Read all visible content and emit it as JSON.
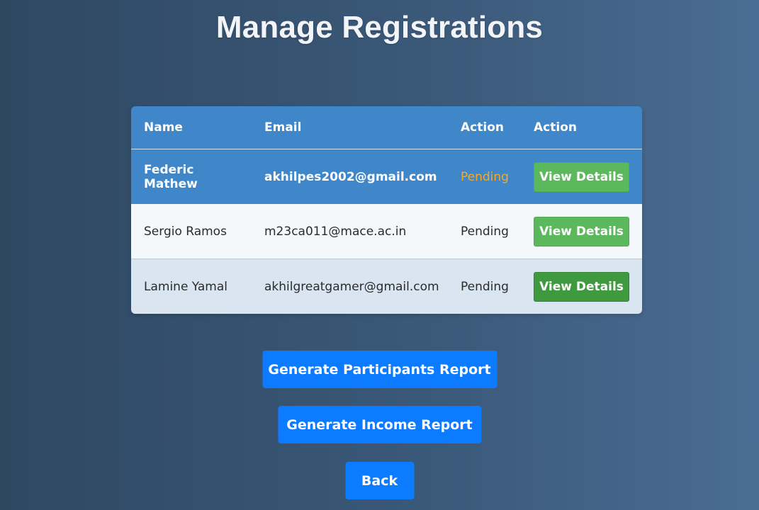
{
  "page": {
    "title": "Manage Registrations"
  },
  "table": {
    "headers": [
      "Name",
      "Email",
      "Action",
      "Action"
    ],
    "rows": [
      {
        "name": "Federic Mathew",
        "email": "akhilpes2002@gmail.com",
        "status": "Pending",
        "action_label": "View Details"
      },
      {
        "name": "Sergio Ramos",
        "email": "m23ca011@mace.ac.in",
        "status": "Pending",
        "action_label": "View Details"
      },
      {
        "name": "Lamine Yamal",
        "email": "akhilgreatgamer@gmail.com",
        "status": "Pending",
        "action_label": "View Details"
      }
    ]
  },
  "buttons": {
    "participants_report": "Generate Participants Report",
    "income_report": "Generate Income Report",
    "back": "Back"
  },
  "colors": {
    "header_bg": "#3f87c8",
    "status_pending": "#f5a623",
    "view_button": "#5cb85c",
    "primary_button": "#0d7bff"
  }
}
